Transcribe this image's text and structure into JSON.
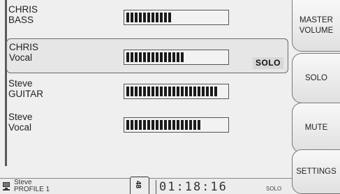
{
  "channels": [
    {
      "name": "CHRIS",
      "instrument": "BASS",
      "level": 0.45,
      "selected": false,
      "solo_label": ""
    },
    {
      "name": "CHRIS",
      "instrument": "Vocal",
      "level": 0.58,
      "selected": true,
      "solo_label": "SOLO"
    },
    {
      "name": "Steve",
      "instrument": "GUITAR",
      "level": 0.92,
      "selected": false,
      "solo_label": ""
    },
    {
      "name": "Steve",
      "instrument": "Vocal",
      "level": 0.75,
      "selected": false,
      "solo_label": ""
    }
  ],
  "side_buttons": {
    "master_volume": "MASTER VOLUME",
    "solo": "SOLO",
    "mute": "MUTE",
    "settings": "SETTINGS"
  },
  "status_bar": {
    "profile_name": "Steve",
    "profile_label": "PROFILE 1",
    "sample_rate": "48",
    "time": "01:18:16",
    "mode": "SOLO"
  },
  "icons": {
    "profile": "person-computer-icon"
  }
}
